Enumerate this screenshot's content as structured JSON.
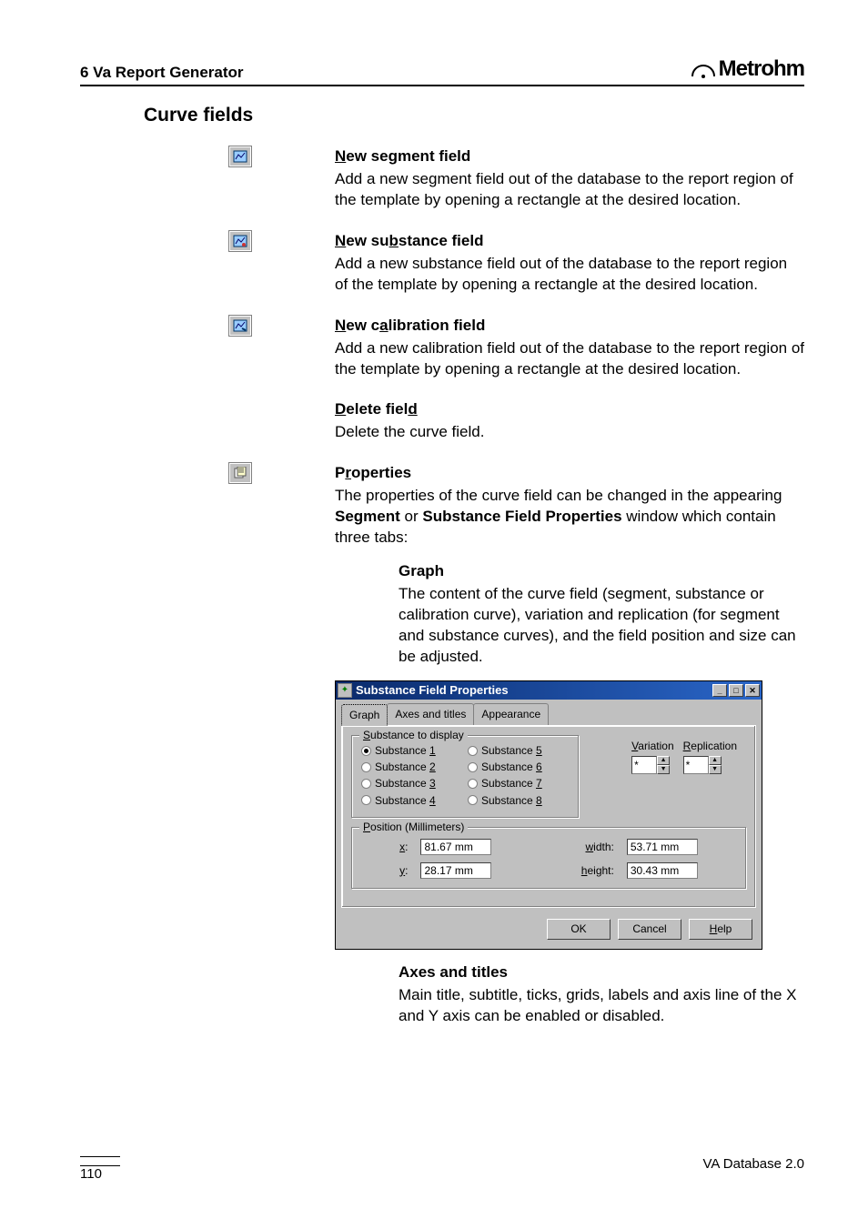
{
  "header": {
    "section": "6  Va Report Generator",
    "brand": "Metrohm"
  },
  "subtitle": "Curve fields",
  "sections": [
    {
      "heading": "New segment field",
      "body": "Add a new segment field out of the database to the report region of the template by opening a rectangle at the desired location."
    },
    {
      "heading": "New substance field",
      "body": "Add a new substance field out of the database to the report region of the template by opening a rectangle at the desired location."
    },
    {
      "heading": "New calibration field",
      "body": "Add a new calibration field out of the database to the report region of the template by opening a rectangle at the desired location."
    },
    {
      "heading": "Delete field",
      "body": "Delete the curve field."
    }
  ],
  "properties_sec": {
    "heading": "Properties",
    "line1": "The properties of the curve field can be changed in the appearing ",
    "dlg_name": "Segment",
    "or": " or ",
    "dlg_name2": "Substance Field Properties",
    "line2": " window which contain three tabs:"
  },
  "tab_graph": {
    "name": "Graph",
    "body": "The content of the curve field (segment, substance or calibration curve), variation and replication (for segment and substance curves), and the field position and size can be adjusted."
  },
  "dialog": {
    "title": "Substance Field Properties",
    "tabs": [
      "Graph",
      "Axes and titles",
      "Appearance"
    ],
    "group1_title_pre": "S",
    "group1_title_rest": "ubstance to display",
    "radios": [
      {
        "n": "1",
        "sel": true
      },
      {
        "n": "5",
        "sel": false
      },
      {
        "n": "2",
        "sel": false
      },
      {
        "n": "6",
        "sel": false
      },
      {
        "n": "3",
        "sel": false
      },
      {
        "n": "7",
        "sel": false
      },
      {
        "n": "4",
        "sel": false
      },
      {
        "n": "8",
        "sel": false
      }
    ],
    "variation_lbl_pre": "V",
    "variation_lbl_rest": "ariation",
    "variation_val": "*",
    "replication_lbl_pre": "R",
    "replication_lbl_rest": "eplication",
    "replication_val": "*",
    "group2_title_pre": "P",
    "group2_title_rest": "osition (Millimeters)",
    "x_lbl_pre": "x",
    "x_lbl_rest": ":",
    "x_val": "81.67 mm",
    "w_lbl_pre": "w",
    "w_lbl_rest": "idth:",
    "w_val": "53.71 mm",
    "y_lbl_pre": "y",
    "y_lbl_rest": ":",
    "y_val": "28.17 mm",
    "h_lbl_pre": "h",
    "h_lbl_rest": "eight:",
    "h_val": "30.43 mm",
    "btn_ok": "OK",
    "btn_cancel": "Cancel",
    "btn_help_pre": "H",
    "btn_help_rest": "elp"
  },
  "tab_axes": {
    "name": "Axes and titles",
    "body": "Main title, subtitle, ticks, grids, labels and axis line of the X and Y axis can be enabled or disabled."
  },
  "footer": {
    "page": "110",
    "product": "VA Database 2.0"
  }
}
